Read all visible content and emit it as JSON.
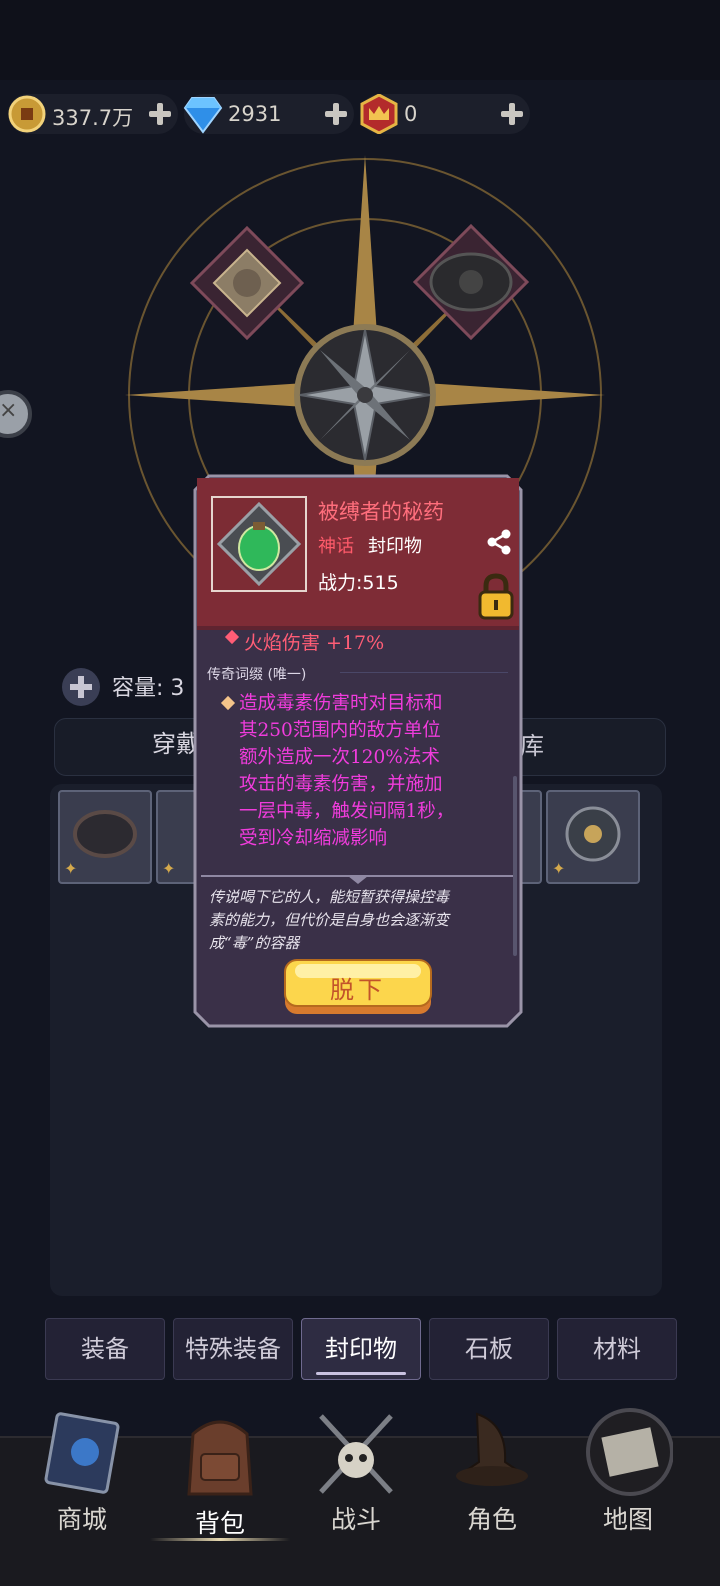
{
  "currency": {
    "gold": "337.7万",
    "diamond": "2931",
    "crown": "0"
  },
  "inventory": {
    "capacity_label": "容量: 3",
    "subtab_left": "穿戴",
    "subtab_right": "库"
  },
  "categories": [
    {
      "label": "装备",
      "active": false
    },
    {
      "label": "特殊装备",
      "active": false
    },
    {
      "label": "封印物",
      "active": true
    },
    {
      "label": "石板",
      "active": false
    },
    {
      "label": "材料",
      "active": false
    }
  ],
  "nav": [
    {
      "label": "商城",
      "icon": "book-icon"
    },
    {
      "label": "背包",
      "icon": "backpack-icon",
      "active": true
    },
    {
      "label": "战斗",
      "icon": "crossed-swords-skull-icon"
    },
    {
      "label": "角色",
      "icon": "wizard-hat-icon"
    },
    {
      "label": "地图",
      "icon": "map-icon"
    }
  ],
  "item_popup": {
    "name": "被缚者的秘药",
    "rarity": "神话",
    "type": "封印物",
    "power": "战力:515",
    "stat": "火焰伤害 +17%",
    "affix_header": "传奇词缀 (唯一)",
    "affix_lines": [
      "造成毒素伤害时对目标和",
      "其250范围内的敌方单位",
      "额外造成一次120%法术",
      "攻击的毒素伤害，并施加",
      "一层中毒，触发间隔1秒，",
      "受到冷却缩减影响"
    ],
    "lore_lines": [
      "传说喝下它的人，能短暂获得操控毒",
      "素的能力，但代价是自身也会逐渐变",
      "成“毒”的容器"
    ],
    "unequip_label": "脱下",
    "icons": [
      "share-icon",
      "lock-icon"
    ]
  },
  "colors": {
    "mythic": "#ff5a6a",
    "affix_text": "#f03cdc",
    "gold_accent": "#d4a94c"
  }
}
